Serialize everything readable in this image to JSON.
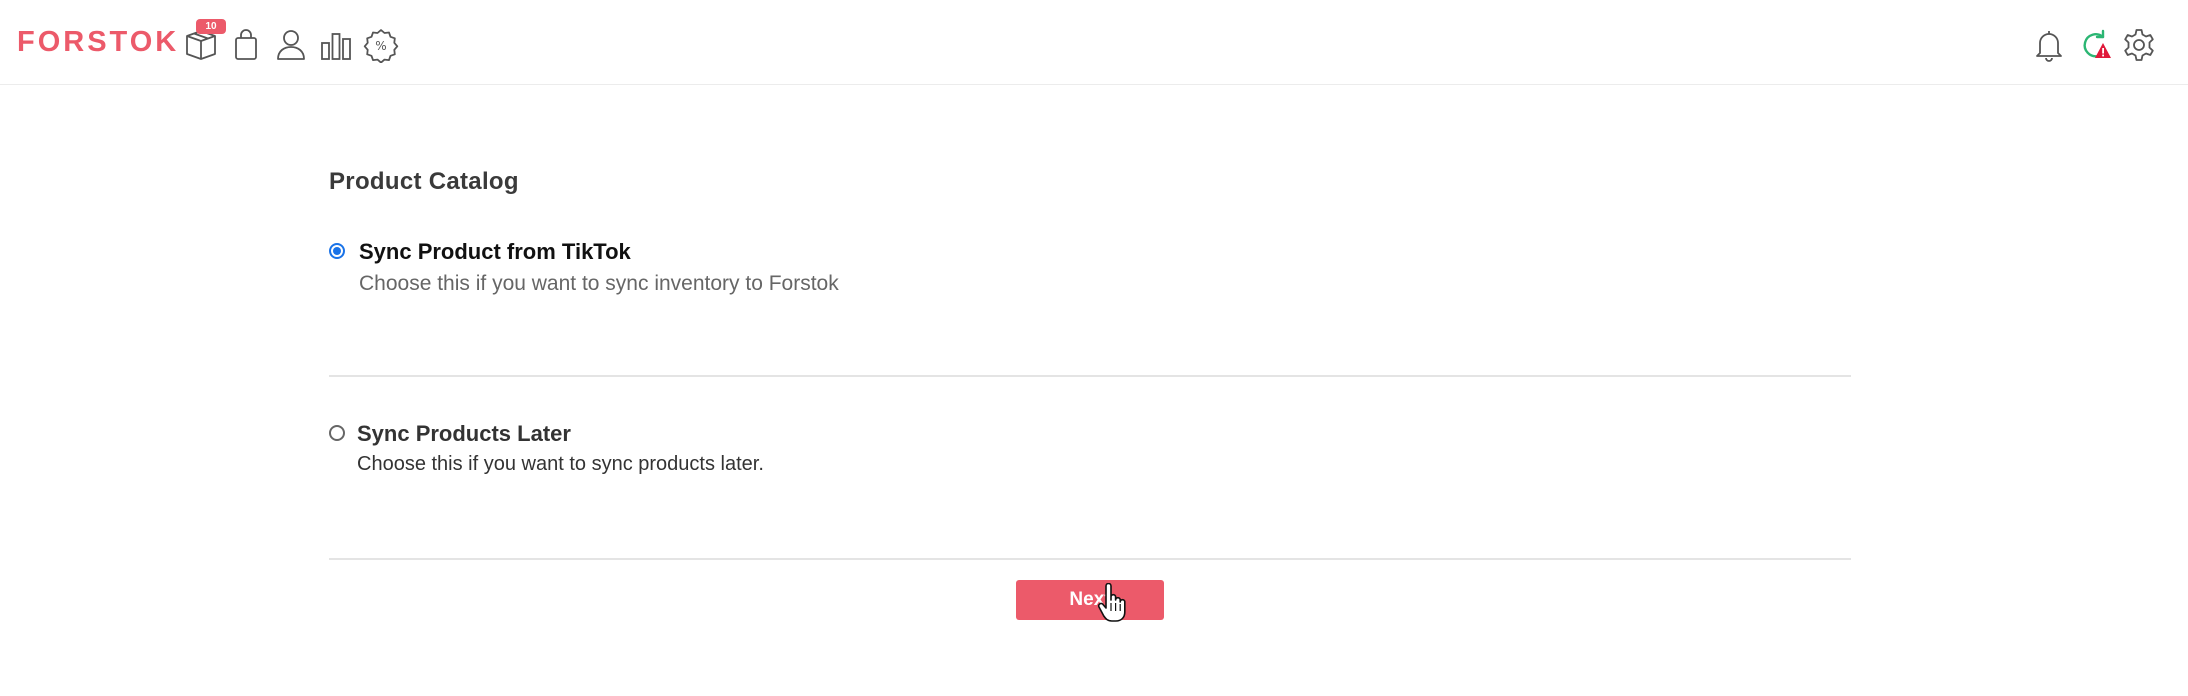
{
  "app": {
    "logo_text": "FORSTOK",
    "brand_color": "#ec5a6a"
  },
  "topbar": {
    "left_icons": [
      {
        "name": "package-box-icon",
        "badge": "10"
      },
      {
        "name": "shopping-bag-icon"
      },
      {
        "name": "user-icon"
      },
      {
        "name": "bar-chart-icon"
      },
      {
        "name": "discount-percent-icon"
      }
    ],
    "right_icons": [
      {
        "name": "bell-icon"
      },
      {
        "name": "sync-warning-icon",
        "status_color": "#e0193a"
      },
      {
        "name": "gear-icon"
      }
    ]
  },
  "main": {
    "title": "Product Catalog",
    "options": [
      {
        "title": "Sync Product from TikTok",
        "description": "Choose this if you want to sync inventory to Forstok",
        "selected": true
      },
      {
        "title": "Sync Products Later",
        "description": "Choose this if you want to sync products later.",
        "selected": false
      }
    ],
    "next_label": "Next",
    "accent_color": "#1a73e8"
  }
}
